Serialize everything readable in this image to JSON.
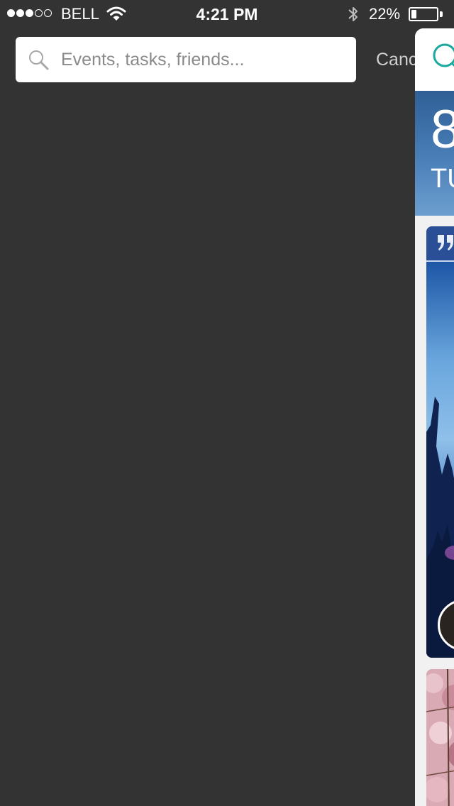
{
  "status_bar": {
    "carrier": "BELL",
    "time": "4:21 PM",
    "battery_percent": "22%",
    "battery_level": 0.22,
    "signal_bars_filled": 3,
    "signal_bars_total": 5
  },
  "search": {
    "placeholder": "Events, tasks, friends...",
    "value": "",
    "cancel_label": "Cancel"
  },
  "app_panel": {
    "date_day": "8",
    "date_weekday": "TUE",
    "accent_color": "#1aa89c",
    "banner_color": "#3a6ea8"
  },
  "colors": {
    "background": "#333333",
    "search_field": "#ffffff",
    "placeholder": "#8a8a8a"
  }
}
